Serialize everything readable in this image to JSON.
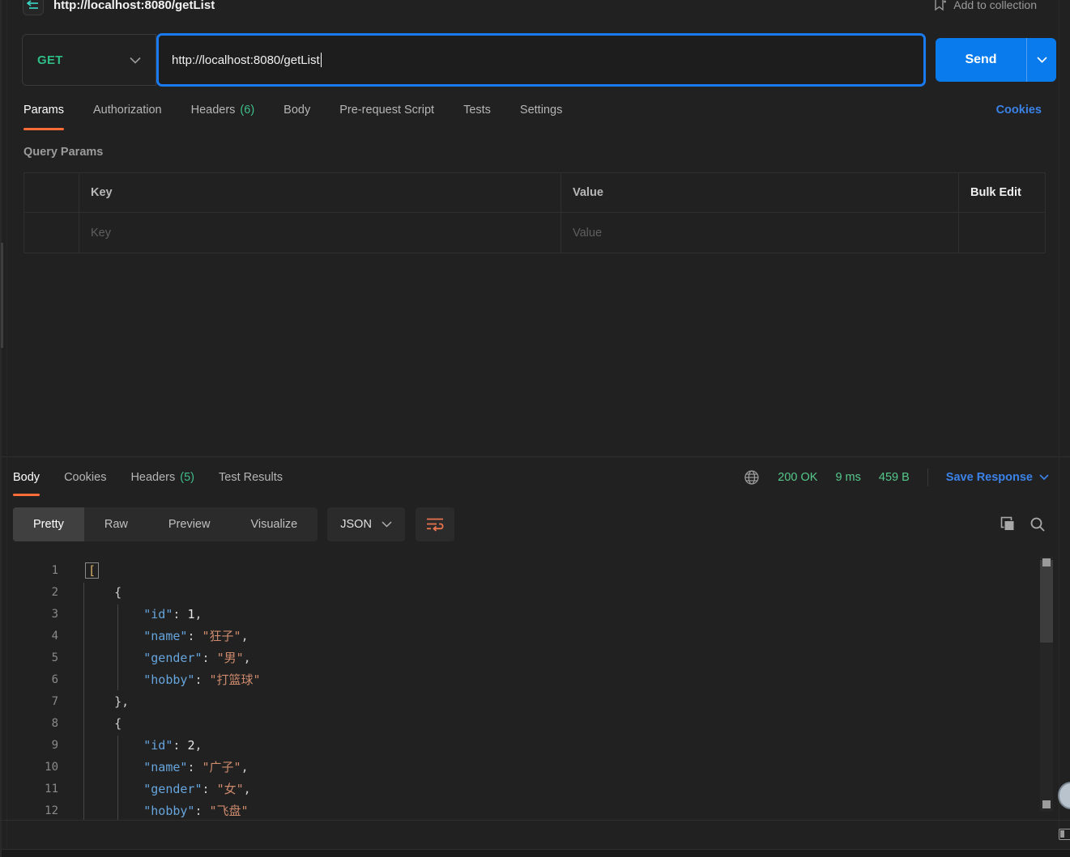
{
  "topbar": {
    "title": "http://localhost:8080/getList",
    "add_to_collection": "Add to collection"
  },
  "request": {
    "method": "GET",
    "url": "http://localhost:8080/getList",
    "send_label": "Send"
  },
  "request_tabs": [
    {
      "label": "Params",
      "active": true
    },
    {
      "label": "Authorization"
    },
    {
      "label": "Headers",
      "count": "(6)"
    },
    {
      "label": "Body"
    },
    {
      "label": "Pre-request Script"
    },
    {
      "label": "Tests"
    },
    {
      "label": "Settings"
    }
  ],
  "cookies_link": "Cookies",
  "query_params": {
    "heading": "Query Params",
    "key_header": "Key",
    "value_header": "Value",
    "bulk_edit_label": "Bulk Edit",
    "key_placeholder": "Key",
    "value_placeholder": "Value"
  },
  "response": {
    "tabs": [
      {
        "label": "Body",
        "active": true
      },
      {
        "label": "Cookies"
      },
      {
        "label": "Headers",
        "count": "(5)"
      },
      {
        "label": "Test Results"
      }
    ],
    "status": "200 OK",
    "time": "9 ms",
    "size": "459 B",
    "save_label": "Save Response"
  },
  "viewer": {
    "views": [
      "Pretty",
      "Raw",
      "Preview",
      "Visualize"
    ],
    "active_view": "Pretty",
    "format": "JSON"
  },
  "colors": {
    "accent_orange": "#ff6c37",
    "method_green": "#2ebd85",
    "status_green": "#55c98c",
    "link_blue": "#3b82e8",
    "send_blue": "#097bed"
  },
  "code": {
    "lines": [
      {
        "n": "1",
        "tokens": [
          {
            "c": "bracketbox",
            "v": "["
          }
        ]
      },
      {
        "n": "2",
        "tokens": [
          {
            "c": "punct",
            "v": "    {"
          }
        ]
      },
      {
        "n": "3",
        "tokens": [
          {
            "c": "punct",
            "v": "        "
          },
          {
            "c": "key",
            "v": "\"id\""
          },
          {
            "c": "punct",
            "v": ": "
          },
          {
            "c": "num",
            "v": "1"
          },
          {
            "c": "punct",
            "v": ","
          }
        ]
      },
      {
        "n": "4",
        "tokens": [
          {
            "c": "punct",
            "v": "        "
          },
          {
            "c": "key",
            "v": "\"name\""
          },
          {
            "c": "punct",
            "v": ": "
          },
          {
            "c": "str",
            "v": "\"狂子\""
          },
          {
            "c": "punct",
            "v": ","
          }
        ]
      },
      {
        "n": "5",
        "tokens": [
          {
            "c": "punct",
            "v": "        "
          },
          {
            "c": "key",
            "v": "\"gender\""
          },
          {
            "c": "punct",
            "v": ": "
          },
          {
            "c": "str",
            "v": "\"男\""
          },
          {
            "c": "punct",
            "v": ","
          }
        ]
      },
      {
        "n": "6",
        "tokens": [
          {
            "c": "punct",
            "v": "        "
          },
          {
            "c": "key",
            "v": "\"hobby\""
          },
          {
            "c": "punct",
            "v": ": "
          },
          {
            "c": "str",
            "v": "\"打篮球\""
          }
        ]
      },
      {
        "n": "7",
        "tokens": [
          {
            "c": "punct",
            "v": "    },"
          }
        ]
      },
      {
        "n": "8",
        "tokens": [
          {
            "c": "punct",
            "v": "    {"
          }
        ]
      },
      {
        "n": "9",
        "tokens": [
          {
            "c": "punct",
            "v": "        "
          },
          {
            "c": "key",
            "v": "\"id\""
          },
          {
            "c": "punct",
            "v": ": "
          },
          {
            "c": "num",
            "v": "2"
          },
          {
            "c": "punct",
            "v": ","
          }
        ]
      },
      {
        "n": "10",
        "tokens": [
          {
            "c": "punct",
            "v": "        "
          },
          {
            "c": "key",
            "v": "\"name\""
          },
          {
            "c": "punct",
            "v": ": "
          },
          {
            "c": "str",
            "v": "\"广子\""
          },
          {
            "c": "punct",
            "v": ","
          }
        ]
      },
      {
        "n": "11",
        "tokens": [
          {
            "c": "punct",
            "v": "        "
          },
          {
            "c": "key",
            "v": "\"gender\""
          },
          {
            "c": "punct",
            "v": ": "
          },
          {
            "c": "str",
            "v": "\"女\""
          },
          {
            "c": "punct",
            "v": ","
          }
        ]
      },
      {
        "n": "12",
        "tokens": [
          {
            "c": "punct",
            "v": "        "
          },
          {
            "c": "key",
            "v": "\"hobby\""
          },
          {
            "c": "punct",
            "v": ": "
          },
          {
            "c": "str",
            "v": "\"飞盘\""
          }
        ]
      }
    ]
  }
}
